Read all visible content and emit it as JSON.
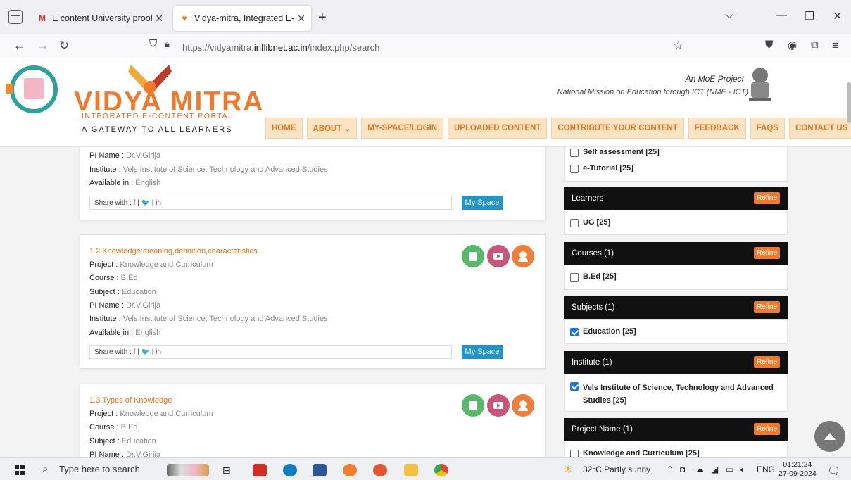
{
  "browser": {
    "tabs": [
      {
        "title": "E content University proof - giri",
        "close": "✕",
        "favicon": "M"
      },
      {
        "title": "Vidya-mitra, Integrated E-Conte",
        "close": "✕",
        "favicon": "♥"
      }
    ],
    "new_tab": "+",
    "url_prefix": "https://vidyamitra.",
    "url_domain": "inflibnet.ac.in",
    "url_path": "/index.php/search",
    "window": {
      "list": "⌵",
      "minimize": "—",
      "restore": "❐",
      "close": "✕"
    }
  },
  "site": {
    "brand": "VIDYA MITRA",
    "brand_sub": "INTEGRATED E-CONTENT PORTAL",
    "tagline": "A GATEWAY TO ALL LEARNERS",
    "moe_title": "An MoE Project",
    "moe_sub": "National Mission on Education through ICT (NME - ICT)",
    "menu": [
      "HOME",
      "ABOUT ⌄",
      "MY-SPACE/LOGIN",
      "UPLOADED CONTENT",
      "CONTRIBUTE YOUR CONTENT",
      "FEEDBACK",
      "FAQS",
      "CONTACT US"
    ]
  },
  "labels": {
    "project": "Project :",
    "course": "Course :",
    "subject": "Subject :",
    "pi": "PI Name :",
    "institute": "Institute :",
    "available": "Available in :",
    "share": "Share with :  f  |  🐦  |  in",
    "myspace": "My Space"
  },
  "results": [
    {
      "title": "",
      "project": "",
      "course": "",
      "subject": "",
      "pi": "Dr.V.Girija",
      "institute": "Vels Institute of Science, Technology and Advanced Studies",
      "available": "English"
    },
    {
      "title": "1.2.Knowledge:meaning,definition,characteristics",
      "project": "Knowledge and Curriculum",
      "course": "B.Ed",
      "subject": "Education",
      "pi": "Dr.V.Girija",
      "institute": "Vels Institute of Science, Technology and Advanced Studies",
      "available": "English"
    },
    {
      "title": "1.3.Types of Knowledge",
      "project": "Knowledge and Curriculum",
      "course": "B.Ed",
      "subject": "Education",
      "pi": "Dr.V.Girija"
    }
  ],
  "filters": {
    "refine": "Refine",
    "types": [
      {
        "label": "Self assessment [25]",
        "checked": false
      },
      {
        "label": "e-Tutorial [25]",
        "checked": false
      }
    ],
    "groups": [
      {
        "title": "Learners",
        "items": [
          {
            "label": "UG [25]",
            "checked": false
          }
        ]
      },
      {
        "title": "Courses (1)",
        "items": [
          {
            "label": "B.Ed [25]",
            "checked": false
          }
        ]
      },
      {
        "title": "Subjects (1)",
        "items": [
          {
            "label": "Education [25]",
            "checked": true
          }
        ]
      },
      {
        "title": "Institute (1)",
        "items": [
          {
            "label": "Vels Institute of Science, Technology and Advanced Studies [25]",
            "checked": true
          }
        ]
      },
      {
        "title": "Project Name (1)",
        "items": [
          {
            "label": "Knowledge and Curriculum [25]",
            "checked": false
          }
        ]
      }
    ]
  },
  "taskbar": {
    "search_placeholder": "Type here to search",
    "weather": "32°C  Partly sunny",
    "lang": "ENG",
    "time": "01:21:24",
    "date": "27-09-2024"
  },
  "colors": {
    "accent": "#e8741c",
    "menu_bg": "#fde4c4",
    "filter_head": "#111111",
    "myspace": "#2394c9"
  }
}
